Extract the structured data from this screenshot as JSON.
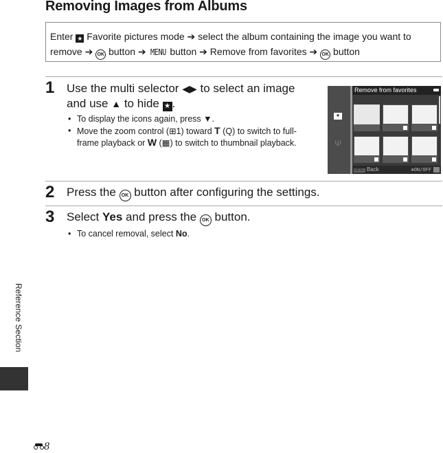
{
  "page_title": "Removing Images from Albums",
  "summary": {
    "enter": "Enter",
    "mode": "Favorite pictures mode",
    "arrow": "➔",
    "select_album": "select the album containing the image you want to",
    "remove": "remove",
    "ok_button": "button",
    "menu": "MENU",
    "menu_button": "button",
    "remove_from_favorites": "Remove from favorites",
    "final_button": "button",
    "ok_glyph": "OK",
    "fav_glyph": "★"
  },
  "steps": [
    {
      "number": "1",
      "line1_a": "Use the multi selector",
      "line1_glyph": "◀▶",
      "line1_b": "to select an image",
      "line2_a": "and use",
      "line2_glyph": "▲",
      "line2_b": "to hide",
      "line2_end": ".",
      "bullets": [
        {
          "a": "To display the icons again, press",
          "glyph": "▼",
          "b": "."
        },
        {
          "a": "Move the zoom control (",
          "ref": "⊞1",
          "b": ") toward",
          "t": "T",
          "c": "(",
          "tglyph": "Q",
          "d": ") to switch to full-frame playback or",
          "w": "W",
          "e": "(",
          "wglyph": "▦",
          "f": ") to switch to thumbnail playback."
        }
      ]
    },
    {
      "number": "2",
      "text_a": "Press the",
      "text_b": "button after configuring the settings."
    },
    {
      "number": "3",
      "text_a": "Select",
      "bold": "Yes",
      "text_b": "and press the",
      "text_c": "button.",
      "bullets": [
        {
          "a": "To cancel removal, select",
          "bold": "No",
          "b": "."
        }
      ]
    }
  ],
  "camera_screen": {
    "header": "Remove from favorites",
    "footer_back": "Back",
    "footer_back_key": "MENU",
    "footer_onoff": "ON/OFF",
    "thumbnails": [
      {
        "selected": true,
        "favorite": false
      },
      {
        "selected": false,
        "favorite": true
      },
      {
        "selected": false,
        "favorite": true
      },
      {
        "selected": false,
        "favorite": true
      },
      {
        "selected": false,
        "favorite": true
      },
      {
        "selected": false,
        "favorite": true
      }
    ]
  },
  "side_label": "Reference Section",
  "page_number": "8"
}
